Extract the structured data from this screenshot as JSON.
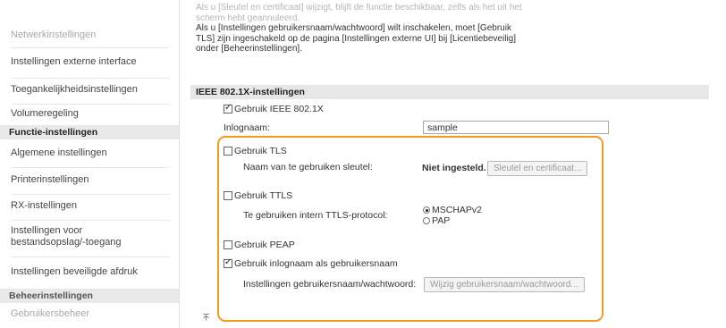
{
  "sidebar": {
    "items": [
      {
        "label": "Netwerkinstellingen",
        "dim": true
      },
      {
        "label": "Instellingen externe interface",
        "dim": false
      },
      {
        "label": "Toegankelijkheidsinstellingen",
        "dim": false
      },
      {
        "label": "Volumeregeling",
        "dim": false
      }
    ],
    "function_header": "Functie-instellingen",
    "function_items": [
      {
        "label": "Algemene instellingen"
      },
      {
        "label": "Printerinstellingen"
      },
      {
        "label": "RX-instellingen"
      },
      {
        "label_line1": "Instellingen voor",
        "label_line2": "bestandsopslag/-toegang"
      },
      {
        "label": "Instellingen beveiligde afdruk"
      }
    ],
    "manage_header": "Beheerinstellingen",
    "manage_items": [
      {
        "label": "Gebruikersbeheer"
      }
    ]
  },
  "notice": {
    "line1": "Als u [Sleutel en certificaat] wijzigt, blijft de functie beschikbaar, zelfs als het uit het",
    "line2": "scherm hebt geannuleerd.",
    "line3": "Als u [Instellingen gebruikersnaam/wachtwoord] wilt inschakelen, moet [Gebruik",
    "line4": "TLS] zijn ingeschakeld op de pagina [Instellingen externe UI] bij [Licentiebeveilig]",
    "line5": "onder [Beheerinstellingen]."
  },
  "section": {
    "title": "IEEE 802.1X-instellingen"
  },
  "form": {
    "use_ieee_label": "Gebruik IEEE 802.1X",
    "use_ieee_checked": true,
    "login_label": "Inlognaam:",
    "login_value": "sample",
    "use_tls_label": "Gebruik TLS",
    "use_tls_checked": false,
    "key_name_label": "Naam van te gebruiken sleutel:",
    "key_status": "Niet ingesteld.",
    "key_button": "Sleutel en certificaat...",
    "use_ttls_label": "Gebruik TTLS",
    "use_ttls_checked": false,
    "ttls_protocol_label": "Te gebruiken intern TTLS-protocol:",
    "ttls_options": [
      "MSCHAPv2",
      "PAP"
    ],
    "ttls_selected": "MSCHAPv2",
    "use_peap_label": "Gebruik PEAP",
    "use_peap_checked": false,
    "use_login_as_user_label": "Gebruik inlognaam als gebruikersnaam",
    "use_login_as_user_checked": true,
    "user_pw_settings_label": "Instellingen gebruikersnaam/wachtwoord:",
    "user_pw_button": "Wijzig gebruikersnaam/wachtwoord..."
  },
  "colors": {
    "highlight": "#f39a1f",
    "section_bg": "#e7e7e7"
  },
  "footer": {
    "top_icon": "arrow-to-top-icon"
  }
}
